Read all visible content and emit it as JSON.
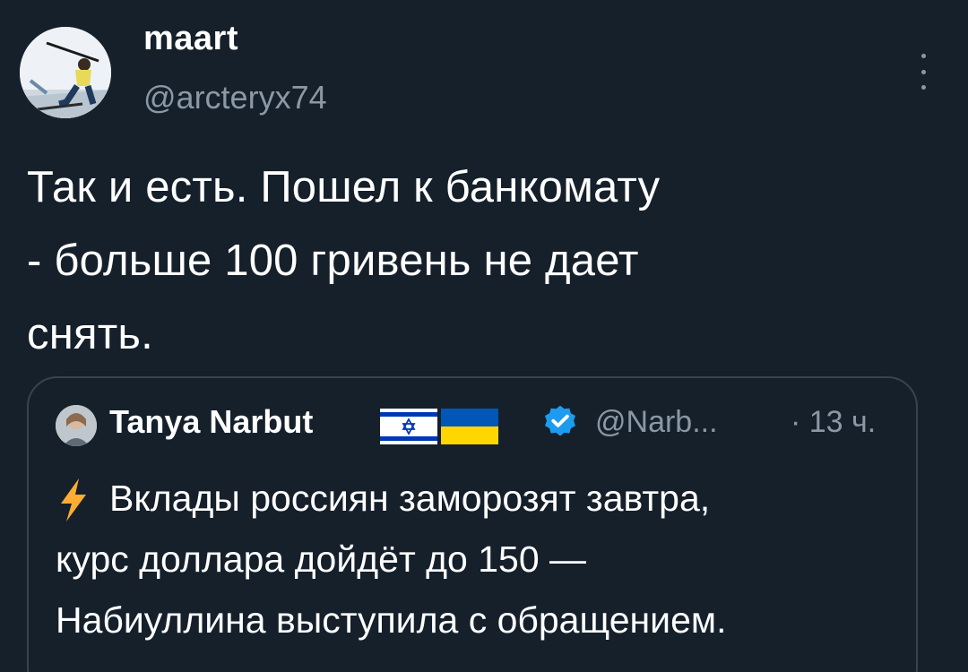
{
  "tweet": {
    "author": {
      "name": "maart",
      "handle": "@arcteryx74",
      "avatar_icon": "skier-avatar"
    },
    "more_icon": "three-dots-vertical-icon",
    "text": "Так и есть. Пошел к банкомату\n- больше 100 гривень не дает\nснять."
  },
  "quote": {
    "author": {
      "name": "Tanya Narbut",
      "handle": "@Narb...",
      "time": "· 13 ч.",
      "verified": true,
      "avatar_icon": "woman-avatar"
    },
    "flags": [
      "israel-flag-icon",
      "ukraine-flag-icon"
    ],
    "lightning_icon": "lightning-icon",
    "text": "Вклады россиян заморозят завтра,\nкурс доллара дойдёт до 150 —\nНабиуллина выступила с обращением."
  },
  "colors": {
    "background": "#15202b",
    "text_primary": "#ffffff",
    "text_secondary": "#8b98a5",
    "border": "#38444d",
    "verified_blue": "#1d9bf0",
    "lightning_yellow": "#ffac33"
  }
}
